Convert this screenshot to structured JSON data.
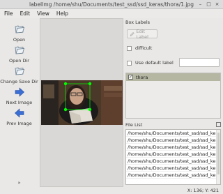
{
  "window": {
    "title": "labelImg /home/shu/Documents/test_ssd/ssd_keras/thora/1.jpg",
    "minimize_glyph": "–",
    "maximize_glyph": "□",
    "close_glyph": "×"
  },
  "menu": {
    "file": "File",
    "edit": "Edit",
    "view": "View",
    "help": "Help"
  },
  "toolbar": {
    "open": "Open",
    "open_dir": "Open Dir",
    "change_save_dir": "Change Save Dir",
    "next_image": "Next Image",
    "prev_image": "Prev Image",
    "more": "»"
  },
  "box_labels": {
    "title": "Box Labels",
    "edit_label": "Edit Label",
    "difficult": "difficult",
    "use_default_label": "Use default label",
    "default_label_value": ""
  },
  "label_list": [
    {
      "name": "thora",
      "checked": true
    }
  ],
  "file_list": {
    "title": "File List",
    "items": [
      "/home/shu/Documents/test_ssd/ssd_keras...",
      "/home/shu/Documents/test_ssd/ssd_keras...",
      "/home/shu/Documents/test_ssd/ssd_keras...",
      "/home/shu/Documents/test_ssd/ssd_keras...",
      "/home/shu/Documents/test_ssd/ssd_keras...",
      "/home/shu/Documents/test_ssd/ssd_keras...",
      "/home/shu/Documents/test_ssd/ssd_keras..."
    ]
  },
  "status": {
    "coords": "X: 136; Y: 421"
  },
  "icons": {
    "open": "open-folder-icon",
    "open_dir": "open-dir-icon",
    "change_save_dir": "save-dir-icon",
    "next": "arrow-right-icon",
    "prev": "arrow-left-icon",
    "edit": "edit-pencil-icon"
  },
  "colors": {
    "label_selected": "#b5b7a2",
    "bbox": "#00ff00",
    "arrow": "#3b6fd6"
  }
}
